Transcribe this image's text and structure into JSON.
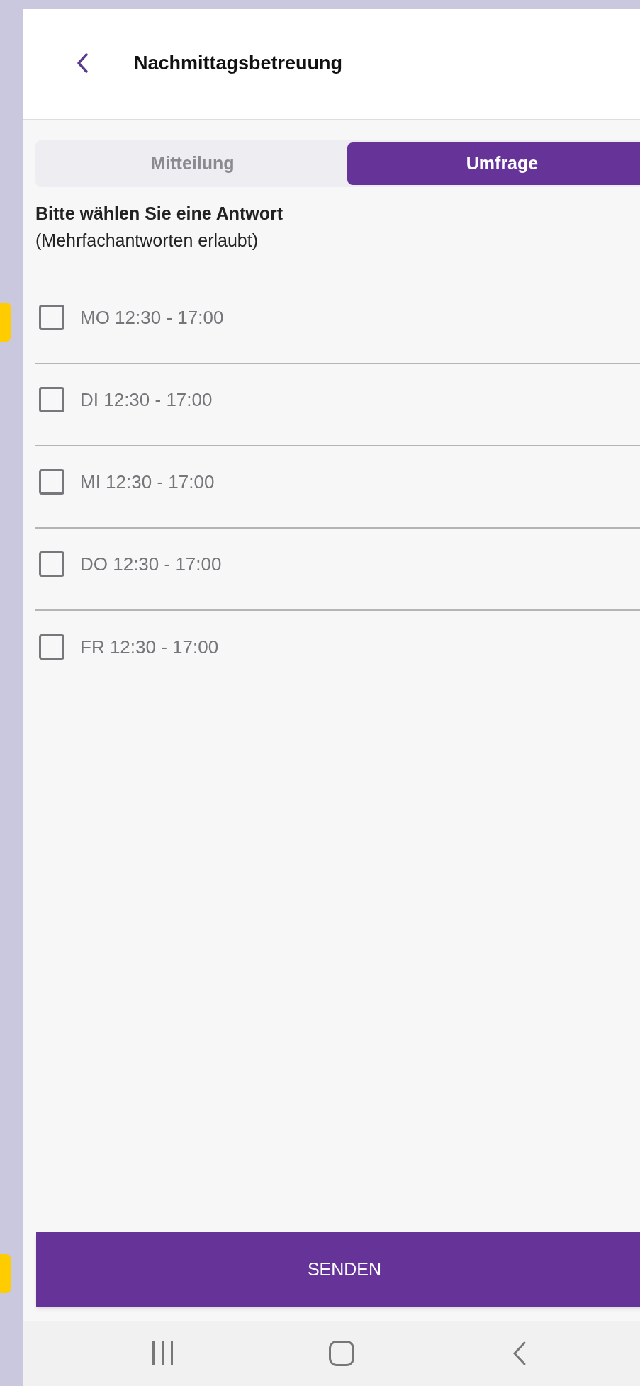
{
  "header": {
    "title": "Nachmittagsbetreuung"
  },
  "tabs": [
    {
      "label": "Mitteilung",
      "selected": false
    },
    {
      "label": "Umfrage",
      "selected": true
    }
  ],
  "question": {
    "title": "Bitte wählen Sie eine Antwort",
    "hint": "(Mehrfachantworten erlaubt)"
  },
  "options": [
    {
      "label": "MO 12:30 - 17:00",
      "checked": false
    },
    {
      "label": "DI 12:30 - 17:00",
      "checked": false
    },
    {
      "label": "MI 12:30 - 17:00",
      "checked": false
    },
    {
      "label": "DO 12:30 - 17:00",
      "checked": false
    },
    {
      "label": "FR 12:30 - 17:00",
      "checked": false
    }
  ],
  "submit_button": "SENDEN"
}
